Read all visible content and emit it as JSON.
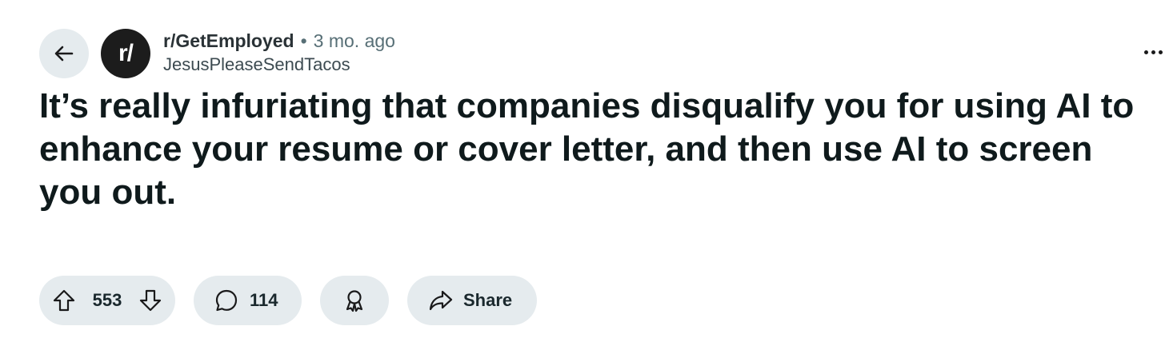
{
  "post": {
    "subreddit": "r/GetEmployed",
    "separator": "•",
    "time_ago": "3 mo. ago",
    "author": "JesusPleaseSendTacos",
    "avatar_text": "r/",
    "title": "It’s really infuriating that companies disqualify you for using AI to enhance your resume or cover letter, and then use AI to screen you out."
  },
  "actions": {
    "upvote_count": "553",
    "comment_count": "114",
    "share_label": "Share"
  },
  "icons": {
    "back": "arrow-left-icon",
    "more": "more-horizontal-icon",
    "upvote": "arrow-up-outline-icon",
    "downvote": "arrow-down-outline-icon",
    "comment": "speech-bubble-icon",
    "award": "award-ribbon-icon",
    "share": "share-arrow-icon"
  },
  "colors": {
    "pill_background": "#e5ebee",
    "avatar_background": "#1c1c1c",
    "meta_text": "#576f76"
  }
}
